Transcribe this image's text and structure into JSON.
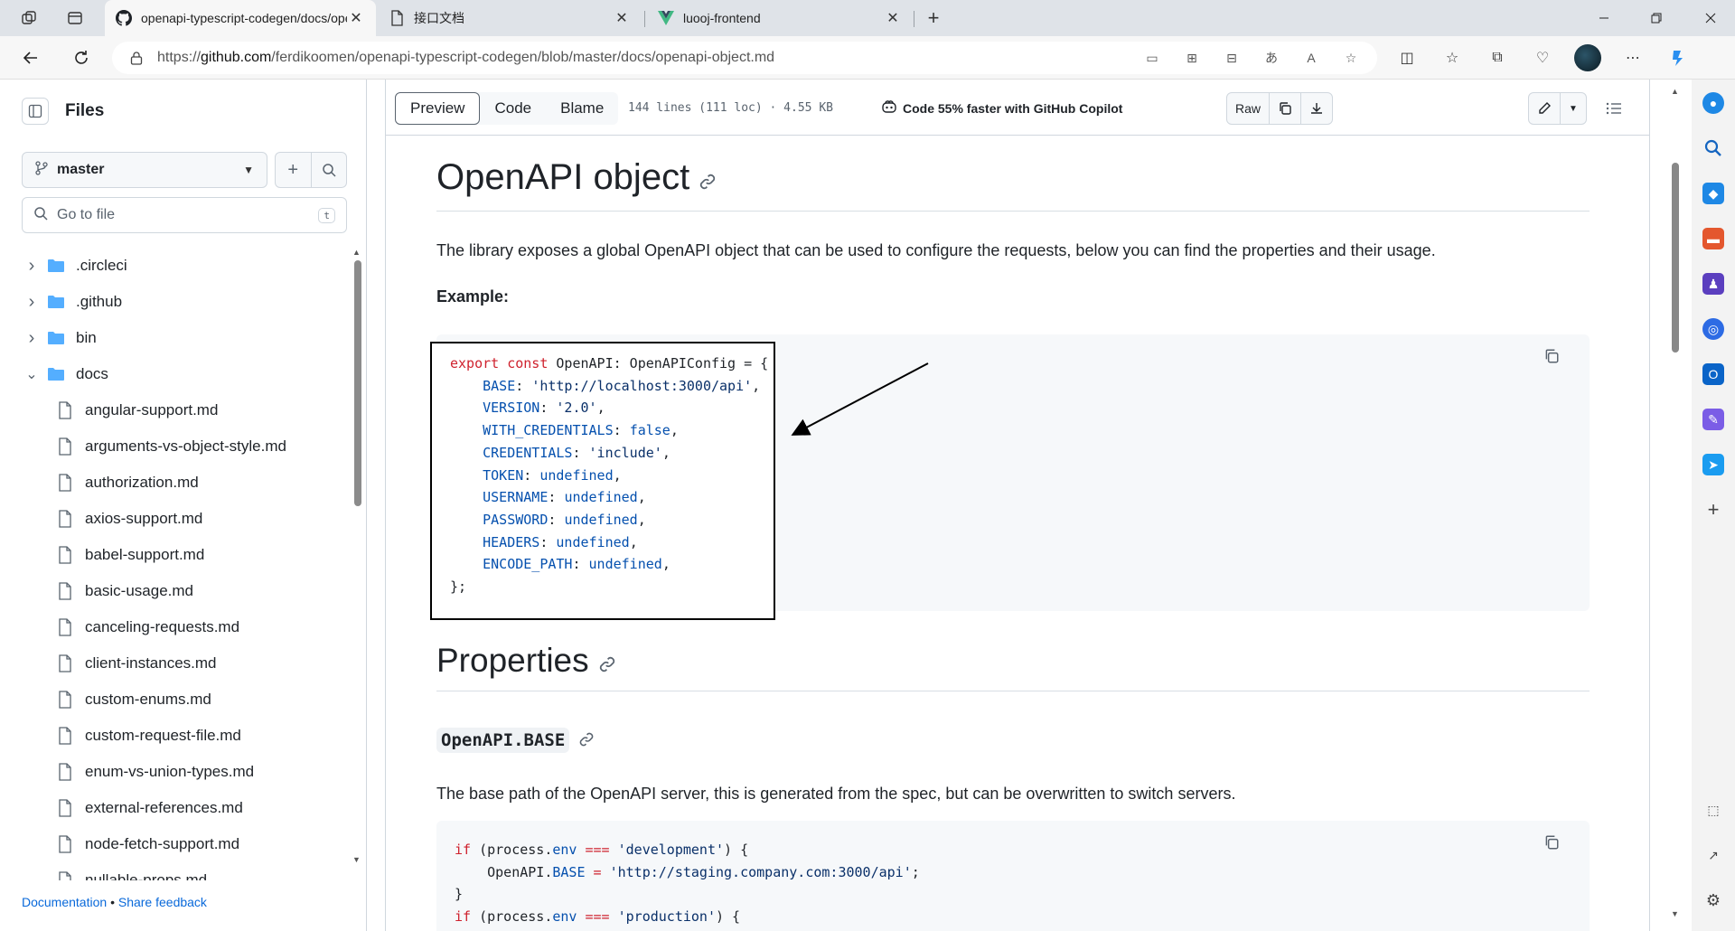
{
  "browser": {
    "tabs": [
      {
        "title": "openapi-typescript-codegen/docs/openapi-object.md at master · ferdikoomen/openapi-typescript-codegen",
        "active": true,
        "favicon": "github-icon"
      },
      {
        "title": "接口文档",
        "active": false,
        "favicon": "document-icon"
      },
      {
        "title": "luooj-frontend",
        "active": false,
        "favicon": "vue-icon"
      }
    ],
    "url_prefix": "https://",
    "url_host": "github.com",
    "url_path": "/ferdikoomen/openapi-typescript-codegen/blob/master/docs/openapi-object.md"
  },
  "files_panel": {
    "title": "Files",
    "branch": "master",
    "goto_placeholder": "Go to file",
    "goto_shortcut": "t",
    "tree": [
      {
        "label": ".circleci",
        "type": "folder",
        "expanded": false
      },
      {
        "label": ".github",
        "type": "folder",
        "expanded": false
      },
      {
        "label": "bin",
        "type": "folder",
        "expanded": false
      },
      {
        "label": "docs",
        "type": "folder",
        "expanded": true
      },
      {
        "label": "angular-support.md",
        "type": "file"
      },
      {
        "label": "arguments-vs-object-style.md",
        "type": "file"
      },
      {
        "label": "authorization.md",
        "type": "file"
      },
      {
        "label": "axios-support.md",
        "type": "file"
      },
      {
        "label": "babel-support.md",
        "type": "file"
      },
      {
        "label": "basic-usage.md",
        "type": "file"
      },
      {
        "label": "canceling-requests.md",
        "type": "file"
      },
      {
        "label": "client-instances.md",
        "type": "file"
      },
      {
        "label": "custom-enums.md",
        "type": "file"
      },
      {
        "label": "custom-request-file.md",
        "type": "file"
      },
      {
        "label": "enum-vs-union-types.md",
        "type": "file"
      },
      {
        "label": "external-references.md",
        "type": "file"
      },
      {
        "label": "node-fetch-support.md",
        "type": "file"
      },
      {
        "label": "nullable-props.md",
        "type": "file"
      }
    ],
    "footer": {
      "documentation": "Documentation",
      "separator": "•",
      "feedback": "Share feedback"
    }
  },
  "toolbar": {
    "tabs": [
      "Preview",
      "Code",
      "Blame"
    ],
    "file_info": "144 lines (111 loc) · 4.55 KB",
    "copilot": "Code 55% faster with GitHub Copilot",
    "raw_label": "Raw"
  },
  "markdown": {
    "h1": "OpenAPI object",
    "intro": "The library exposes a global OpenAPI object that can be used to configure the requests, below you can find the properties and their usage.",
    "example_label": "Example:",
    "h2": "Properties",
    "h3": "OpenAPI.BASE",
    "base_desc": "The base path of the OpenAPI server, this is generated from the spec, but can be overwritten to switch servers."
  },
  "code_example": {
    "line1": {
      "kw": "export const",
      "rest": " OpenAPI: OpenAPIConfig = {"
    },
    "props": [
      {
        "key": "BASE",
        "value": "'http://localhost:3000/api'"
      },
      {
        "key": "VERSION",
        "value": "'2.0'"
      },
      {
        "key": "WITH_CREDENTIALS",
        "value": "false"
      },
      {
        "key": "CREDENTIALS",
        "value": "'include'"
      },
      {
        "key": "TOKEN",
        "value": "undefined"
      },
      {
        "key": "USERNAME",
        "value": "undefined"
      },
      {
        "key": "PASSWORD",
        "value": "undefined"
      },
      {
        "key": "HEADERS",
        "value": "undefined"
      },
      {
        "key": "ENCODE_PATH",
        "value": "undefined"
      }
    ],
    "close": "};"
  },
  "code_base": {
    "line1": {
      "kw": "if",
      "a": " (process.",
      "env": "env",
      "op": " ===",
      "str": " 'development'",
      "end": ") {"
    },
    "line2": {
      "obj": "    OpenAPI.",
      "prop": "BASE",
      "eq": " = ",
      "str": "'http://staging.company.com:3000/api'",
      "end": ";"
    },
    "line3": "}",
    "line4": {
      "kw": "if",
      "a": " (process.",
      "env": "env",
      "op": " ===",
      "str": " 'production'",
      "end": ") {"
    }
  }
}
